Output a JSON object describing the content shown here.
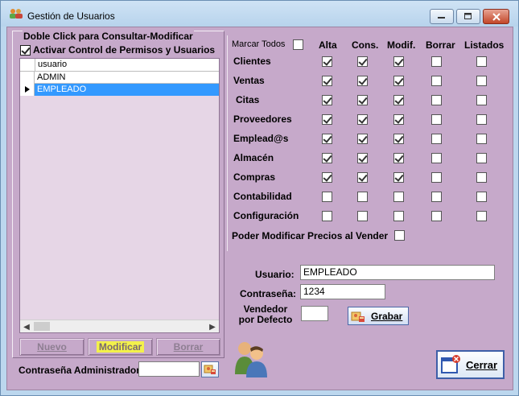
{
  "window": {
    "title": "Gestión de Usuarios"
  },
  "left_panel": {
    "group_label": "Doble Click para Consultar-Modificar",
    "activar_label": "Activar Control de Permisos y Usuarios",
    "activar_checked": true,
    "grid": {
      "column_header": "usuario",
      "rows": [
        "ADMIN",
        "EMPLEADO"
      ],
      "selected_row": "EMPLEADO"
    },
    "buttons": {
      "nuevo": "Nuevo",
      "modificar": "Modificar",
      "borrar": "Borrar"
    },
    "admin_password_label": "Contraseña Administrador:",
    "admin_password_value": ""
  },
  "permissions": {
    "marcar_todos_label": "Marcar Todos",
    "marcar_todos_checked": false,
    "columns": [
      "Alta",
      "Cons.",
      "Modif.",
      "Borrar",
      "Listados"
    ],
    "rows": [
      {
        "label": "Clientes",
        "checks": [
          true,
          true,
          true,
          false,
          false
        ]
      },
      {
        "label": "Ventas",
        "checks": [
          true,
          true,
          true,
          false,
          false
        ]
      },
      {
        "label": "Citas",
        "checks": [
          true,
          true,
          true,
          false,
          false
        ]
      },
      {
        "label": "Proveedores",
        "checks": [
          true,
          true,
          true,
          false,
          false
        ]
      },
      {
        "label": "Emplead@s",
        "checks": [
          true,
          true,
          true,
          false,
          false
        ]
      },
      {
        "label": "Almacén",
        "checks": [
          true,
          true,
          true,
          false,
          false
        ]
      },
      {
        "label": "Compras",
        "checks": [
          true,
          true,
          true,
          false,
          false
        ]
      },
      {
        "label": "Contabilidad",
        "checks": [
          false,
          false,
          false,
          false,
          false
        ]
      },
      {
        "label": "Configuración",
        "checks": [
          false,
          false,
          false,
          false,
          false
        ]
      }
    ],
    "poder_modificar_label": "Poder Modificar Precios al Vender",
    "poder_modificar_checked": false
  },
  "user_form": {
    "usuario_label": "Usuario:",
    "usuario_value": "EMPLEADO",
    "password_label": "Contraseña:",
    "password_value": "1234",
    "vendedor_label": "Vendedor por Defecto",
    "vendedor_value": "",
    "grabar_label": "Grabar",
    "cerrar_label": "Cerrar"
  }
}
